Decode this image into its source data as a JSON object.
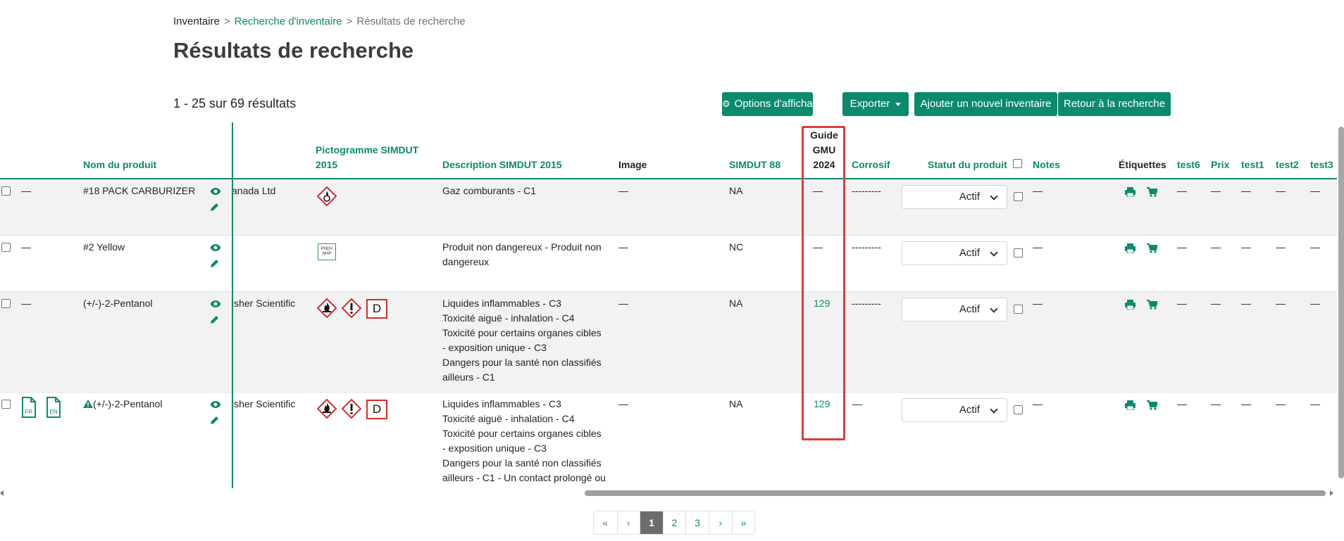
{
  "breadcrumb": {
    "home": "Inventaire",
    "search": "Recherche d'inventaire",
    "current": "Résultats de recherche",
    "separator": ">"
  },
  "page_title": "Résultats de recherche",
  "result_count": "1 - 25 sur 69 résultats",
  "toolbar": {
    "display_options": "Options d'affichage",
    "export": "Exporter",
    "add_inventory": "Ajouter un nouvel inventaire",
    "back_to_search": "Retour à la recherche"
  },
  "columns": {
    "product_name": "Nom du produit",
    "pictogram_1": "Pictogramme SIMDUT",
    "pictogram_2": "2015",
    "description": "Description SIMDUT 2015",
    "image": "Image",
    "simdut88": "SIMDUT 88",
    "guide_1": "Guide",
    "guide_2": "GMU",
    "guide_3": "2024",
    "corrosive": "Corrosif",
    "status": "Statut du produit",
    "notes": "Notes",
    "labels": "Étiquettes",
    "test6": "test6",
    "price": "Prix",
    "test1": "test1",
    "test2": "test2",
    "test3": "test3"
  },
  "rows": [
    {
      "dash": "—",
      "name": "#18 PACK CARBURIZER",
      "supplier": "anada Ltd",
      "description": [
        "Gaz comburants - C1"
      ],
      "image": "—",
      "simdut88": "NA",
      "guide": "—",
      "corrosive": "---------",
      "status": "Actif",
      "notes": "—",
      "extra": [
        "—",
        "—",
        "—",
        "—",
        "—"
      ]
    },
    {
      "dash": "—",
      "name": "#2 Yellow",
      "supplier": "",
      "nhp_label": "PNDV\nNHP",
      "description": [
        "Produit non dangereux - Produit non",
        "dangereux"
      ],
      "image": "—",
      "simdut88": "NC",
      "guide": "—",
      "corrosive": "---------",
      "status": "Actif",
      "notes": "—",
      "extra": [
        "—",
        "—",
        "—",
        "—",
        "—"
      ]
    },
    {
      "dash": "—",
      "name": "(+/-)-2-Pentanol",
      "supplier": "isher Scientific",
      "d_label": "D",
      "description": [
        "Liquides inflammables - C3",
        "Toxicité aiguë - inhalation - C4",
        "Toxicité pour certains organes cibles",
        "- exposition unique - C3",
        "Dangers pour la santé non classifiés",
        "ailleurs - C1"
      ],
      "image": "—",
      "simdut88": "NA",
      "guide": "129",
      "corrosive": "---------",
      "status": "Actif",
      "notes": "—",
      "extra": [
        "—",
        "—",
        "—",
        "—",
        "—"
      ]
    },
    {
      "name": "(+/-)-2-Pentanol",
      "doc_fr": "FR",
      "doc_en": "EN",
      "supplier": "isher Scientific",
      "d_label": "D",
      "description": [
        "Liquides inflammables - C3",
        "Toxicité aiguë - inhalation - C4",
        "Toxicité pour certains organes cibles",
        "- exposition unique - C3",
        "Dangers pour la santé non classifiés",
        "ailleurs - C1 - Un contact prolongé ou"
      ],
      "image": "—",
      "simdut88": "NA",
      "guide": "129",
      "corrosive": "—",
      "status": "Actif",
      "notes": "—",
      "extra": [
        "—",
        "—",
        "—",
        "—",
        "—"
      ]
    }
  ],
  "pagination": {
    "first": "«",
    "prev": "‹",
    "p1": "1",
    "p2": "2",
    "p3": "3",
    "next": "›",
    "last": "»"
  },
  "colors": {
    "accent": "#0b8a6e",
    "highlight": "#e03c3c",
    "hazard_red": "#d62c2c"
  }
}
